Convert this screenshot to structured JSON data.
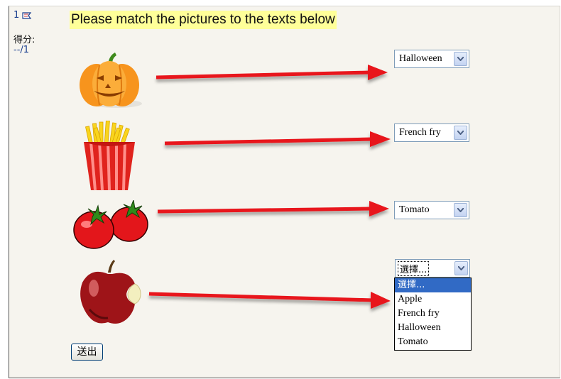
{
  "question": {
    "number": "1",
    "grade_label": "得分:",
    "grade_value": "--/1",
    "title": "Please match the pictures to the texts below"
  },
  "items": [
    {
      "picture": "pumpkin-icon",
      "selected": "Halloween"
    },
    {
      "picture": "french-fries-icon",
      "selected": "French fry"
    },
    {
      "picture": "tomatoes-icon",
      "selected": "Tomato"
    },
    {
      "picture": "apple-icon",
      "selected": "選擇..."
    }
  ],
  "dropdown": {
    "options": [
      "選擇...",
      "Apple",
      "French fry",
      "Halloween",
      "Tomato"
    ],
    "highlighted": "選擇..."
  },
  "submit_label": "送出",
  "colors": {
    "arrow": "#e8121a",
    "title_highlight": "#ffff99",
    "selection": "#316ac5"
  }
}
